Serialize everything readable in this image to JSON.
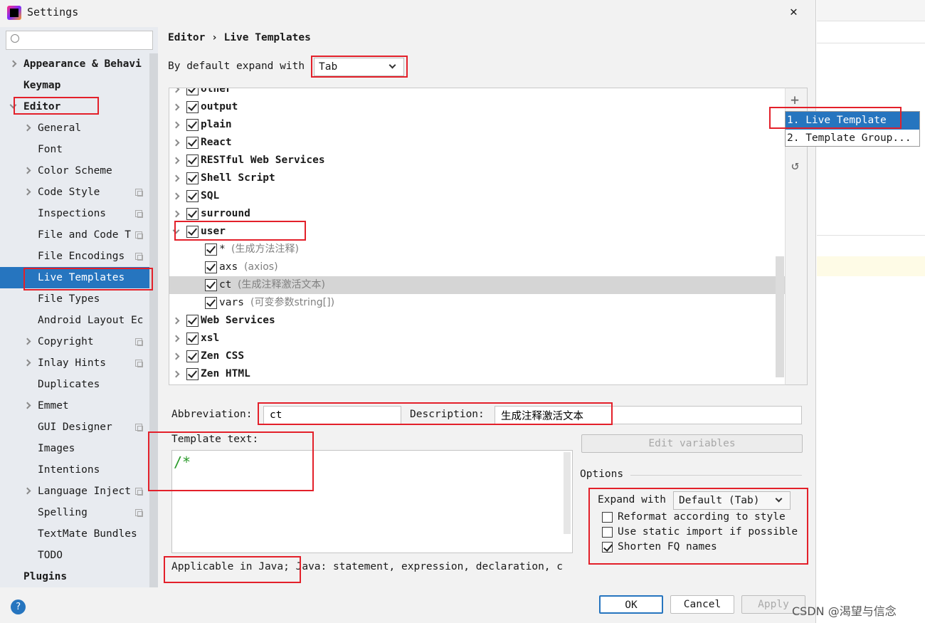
{
  "window": {
    "title": "Settings",
    "close": "✕"
  },
  "search": {
    "placeholder": ""
  },
  "sidebar": {
    "items": [
      {
        "label": "Appearance & Behavi",
        "bold": true,
        "chevron": "right"
      },
      {
        "label": "Keymap",
        "bold": true
      },
      {
        "label": "Editor",
        "bold": true,
        "chevron": "down"
      },
      {
        "label": "General",
        "chevron": "right"
      },
      {
        "label": "Font"
      },
      {
        "label": "Color Scheme",
        "chevron": "right"
      },
      {
        "label": "Code Style",
        "chevron": "right",
        "copy": true
      },
      {
        "label": "Inspections",
        "copy": true
      },
      {
        "label": "File and Code T",
        "copy": true
      },
      {
        "label": "File Encodings",
        "copy": true
      },
      {
        "label": "Live Templates",
        "selected": true
      },
      {
        "label": "File Types"
      },
      {
        "label": "Android Layout Ec"
      },
      {
        "label": "Copyright",
        "chevron": "right",
        "copy": true
      },
      {
        "label": "Inlay Hints",
        "chevron": "right",
        "copy": true
      },
      {
        "label": "Duplicates"
      },
      {
        "label": "Emmet",
        "chevron": "right"
      },
      {
        "label": "GUI Designer",
        "copy": true
      },
      {
        "label": "Images"
      },
      {
        "label": "Intentions"
      },
      {
        "label": "Language Inject",
        "chevron": "right",
        "copy": true
      },
      {
        "label": "Spelling",
        "copy": true
      },
      {
        "label": "TextMate Bundles"
      },
      {
        "label": "TODO"
      },
      {
        "label": "Plugins",
        "bold": true
      }
    ]
  },
  "breadcrumb": {
    "parent": "Editor",
    "sep": "›",
    "current": "Live Templates"
  },
  "expand": {
    "label": "By default expand with",
    "value": "Tab"
  },
  "tree": [
    {
      "label": "other",
      "group": true
    },
    {
      "label": "output",
      "group": true
    },
    {
      "label": "plain",
      "group": true
    },
    {
      "label": "React",
      "group": true
    },
    {
      "label": "RESTful Web Services",
      "group": true
    },
    {
      "label": "Shell Script",
      "group": true
    },
    {
      "label": "SQL",
      "group": true
    },
    {
      "label": "surround",
      "group": true
    },
    {
      "label": "user",
      "group": true,
      "expanded": true
    },
    {
      "label": "*",
      "desc": "(生成方法注释)"
    },
    {
      "label": "axs",
      "desc": "(axios)"
    },
    {
      "label": "ct",
      "desc": "(生成注释激活文本)",
      "selected": true
    },
    {
      "label": "vars",
      "desc": "(可变参数string[])"
    },
    {
      "label": "Web Services",
      "group": true
    },
    {
      "label": "xsl",
      "group": true
    },
    {
      "label": "Zen CSS",
      "group": true
    },
    {
      "label": "Zen HTML",
      "group": true
    }
  ],
  "popup": {
    "items": [
      "1. Live Template",
      "2. Template Group..."
    ]
  },
  "form": {
    "abbreviation_label": "Abbreviation:",
    "abbreviation": "ct",
    "description_label": "Description:",
    "description": "生成注释激活文本",
    "template_label": "Template text:",
    "template_text": "/*",
    "edit_variables": "Edit variables",
    "applicable": "Applicable in Java;",
    "applicable_rest": " Java: statement, expression, declaration, c"
  },
  "options": {
    "title": "Options",
    "expand_label": "Expand with",
    "expand_value": "Default (Tab)",
    "checks": [
      {
        "label": "Reformat according to style",
        "checked": false
      },
      {
        "label": "Use static import if possible",
        "checked": false
      },
      {
        "label": "Shorten FQ names",
        "checked": true
      }
    ]
  },
  "buttons": {
    "ok": "OK",
    "cancel": "Cancel",
    "apply": "Apply",
    "help": "?"
  },
  "watermark": "CSDN @渴望与信念",
  "colors": {
    "selection": "#2675bf",
    "highlight": "#e3202a",
    "comment": "#2a9a2a"
  }
}
